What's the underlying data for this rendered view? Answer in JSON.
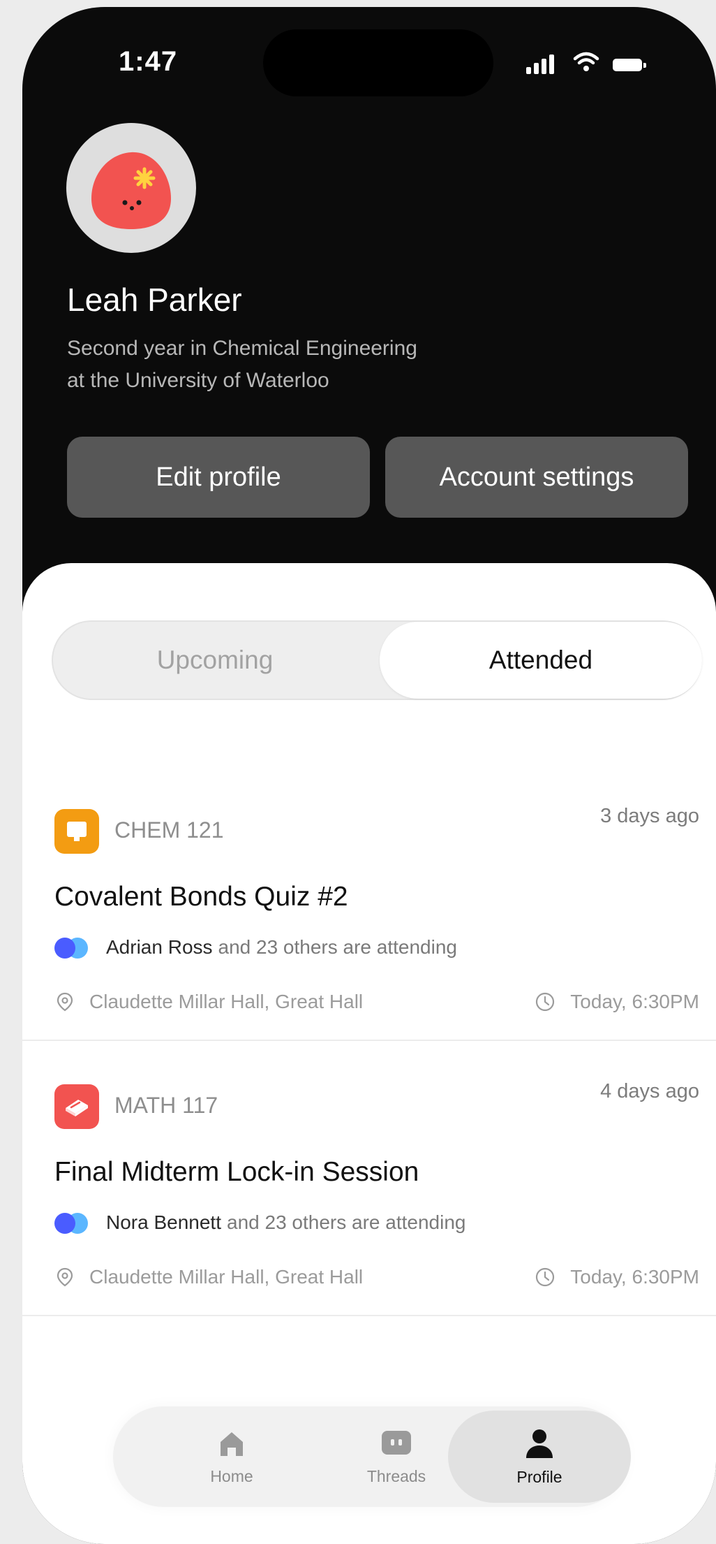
{
  "status_bar": {
    "time": "1:47"
  },
  "profile": {
    "name": "Leah Parker",
    "bio_line1": "Second year in Chemical Engineering",
    "bio_line2": "at the University of Waterloo",
    "edit_button": "Edit profile",
    "settings_button": "Account settings"
  },
  "tabs": {
    "upcoming": "Upcoming",
    "attended": "Attended",
    "selected": "Attended"
  },
  "events": [
    {
      "course": "CHEM 121",
      "course_icon": "monitor-icon",
      "course_color": "#f39c12",
      "ago": "3 days ago",
      "title": "Covalent Bonds Quiz #2",
      "attendee": "Adrian Ross",
      "attending_rest": "and 23 others are attending",
      "location": "Claudette Millar Hall, Great Hall",
      "time": "Today, 6:30PM"
    },
    {
      "course": "MATH 117",
      "course_icon": "book-icon",
      "course_color": "#f25350",
      "ago": "4 days ago",
      "title": "Final Midterm Lock-in Session",
      "attendee": "Nora Bennett",
      "attending_rest": "and 23 others are attending",
      "location": "Claudette Millar Hall, Great Hall",
      "time": "Today, 6:30PM"
    }
  ],
  "nav": {
    "home": "Home",
    "threads": "Threads",
    "profile": "Profile",
    "active": "Profile"
  },
  "colors": {
    "avatar_blob": "#f25350",
    "avatar_star": "#ffd23f",
    "attendee_dot_1": "#4a5cff",
    "attendee_dot_2": "#5bb6ff"
  }
}
